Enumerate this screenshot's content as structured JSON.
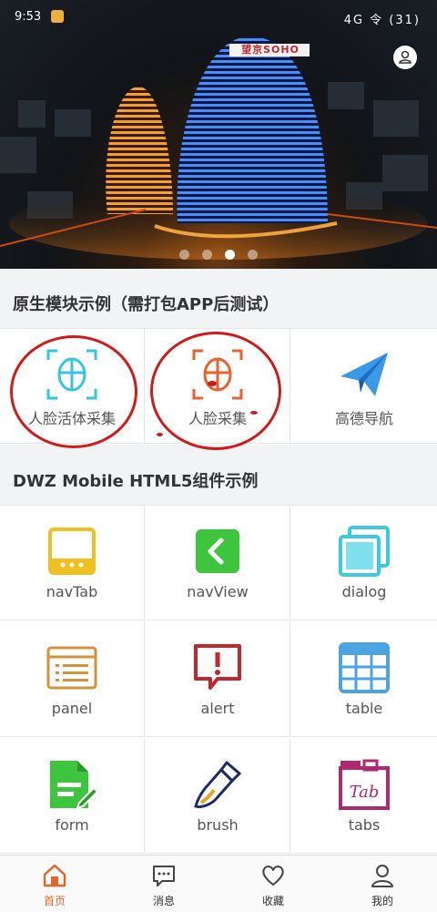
{
  "status_bar": {
    "time": "9:53",
    "right": "4G 令 (31)"
  },
  "banner": {
    "building_sign": "望京SOHO",
    "slide_count": 4,
    "active_slide": 3
  },
  "section_native": {
    "title": "原生模块示例（需打包APP后测试）",
    "items": [
      {
        "label": "人脸活体采集",
        "icon": "face-scan-cyan-icon",
        "color": "#33c6e3"
      },
      {
        "label": "人脸采集",
        "icon": "face-scan-orange-icon",
        "color": "#e8632c"
      },
      {
        "label": "高德导航",
        "icon": "paper-plane-icon",
        "color": "#3a9ae8"
      }
    ]
  },
  "section_dwz": {
    "title": "DWZ Mobile HTML5组件示例",
    "items": [
      {
        "label": "navTab",
        "icon": "navtab-icon",
        "color": "#f0c020"
      },
      {
        "label": "navView",
        "icon": "navview-icon",
        "color": "#3ec53e"
      },
      {
        "label": "dialog",
        "icon": "dialog-icon",
        "color": "#3ccae0"
      },
      {
        "label": "panel",
        "icon": "panel-icon",
        "color": "#d4923a"
      },
      {
        "label": "alert",
        "icon": "alert-icon",
        "color": "#c0282e"
      },
      {
        "label": "table",
        "icon": "table-icon",
        "color": "#4ba4e0"
      },
      {
        "label": "form",
        "icon": "form-icon",
        "color": "#3ec53e"
      },
      {
        "label": "brush",
        "icon": "brush-icon",
        "color": "#1e2a6e"
      },
      {
        "label": "tabs",
        "icon": "tabs-icon",
        "color": "#b0286e"
      }
    ]
  },
  "tabbar": {
    "tabs": [
      {
        "label": "首页",
        "icon": "home-icon",
        "active": true
      },
      {
        "label": "消息",
        "icon": "message-icon",
        "active": false
      },
      {
        "label": "收藏",
        "icon": "heart-icon",
        "active": false
      },
      {
        "label": "我的",
        "icon": "user-icon",
        "active": false
      }
    ]
  },
  "colors": {
    "accent": "#e8632c",
    "annotation_red": "#d11a1a"
  }
}
